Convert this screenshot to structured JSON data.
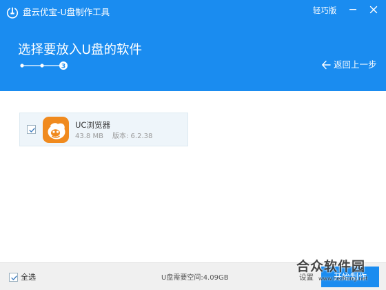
{
  "window": {
    "title": "盘云优宝-U盘制作工具",
    "edition": "轻巧版",
    "icons": {
      "logo": "usb-stick-icon",
      "minimize": "minimize-icon",
      "close": "close-icon"
    }
  },
  "header": {
    "page_title": "选择要放入U盘的软件",
    "steps": {
      "current": 3,
      "total": 3,
      "current_label": "3"
    },
    "back_label": "返回上一步",
    "colors": {
      "brand_blue": "#1a8cf0"
    }
  },
  "software_list": [
    {
      "name": "UC浏览器",
      "size": "43.8 MB",
      "version": "版本: 6.2.38",
      "checked": true,
      "icon": "uc-browser-icon",
      "icon_color": "#f08a1e"
    }
  ],
  "footer": {
    "select_all_label": "全选",
    "select_all_checked": true,
    "space_needed": "U盘需要空间:4.09GB",
    "settings_label": "设置",
    "start_label": "开始制作"
  },
  "watermark": {
    "text": "合众软件园",
    "url": "www.hezhong.net"
  }
}
